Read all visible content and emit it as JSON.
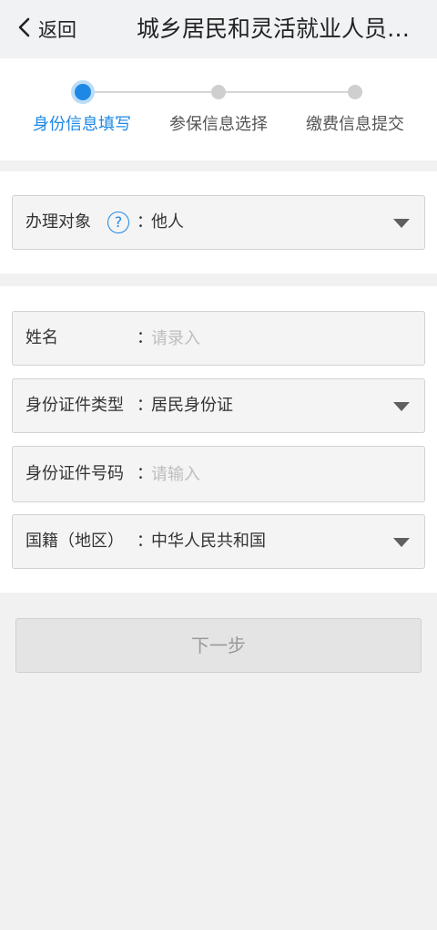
{
  "header": {
    "back_label": "返回",
    "title": "城乡居民和灵活就业人员…"
  },
  "stepper": {
    "active_index": 0,
    "steps": [
      {
        "label": "身份信息填写"
      },
      {
        "label": "参保信息选择"
      },
      {
        "label": "缴费信息提交"
      }
    ],
    "accent_color": "#1e88e5"
  },
  "target_section": {
    "label": "办理对象",
    "help_icon": "question-circle-icon",
    "value": "他人"
  },
  "identity_form": {
    "colon": "：",
    "name": {
      "label": "姓名",
      "placeholder": "请录入"
    },
    "id_type": {
      "label": "身份证件类型",
      "value": "居民身份证"
    },
    "id_number": {
      "label": "身份证件号码",
      "placeholder": "请输入"
    },
    "nationality": {
      "label": "国籍（地区）",
      "value": "中华人民共和国"
    }
  },
  "next_button": {
    "label": "下一步",
    "enabled": false
  }
}
